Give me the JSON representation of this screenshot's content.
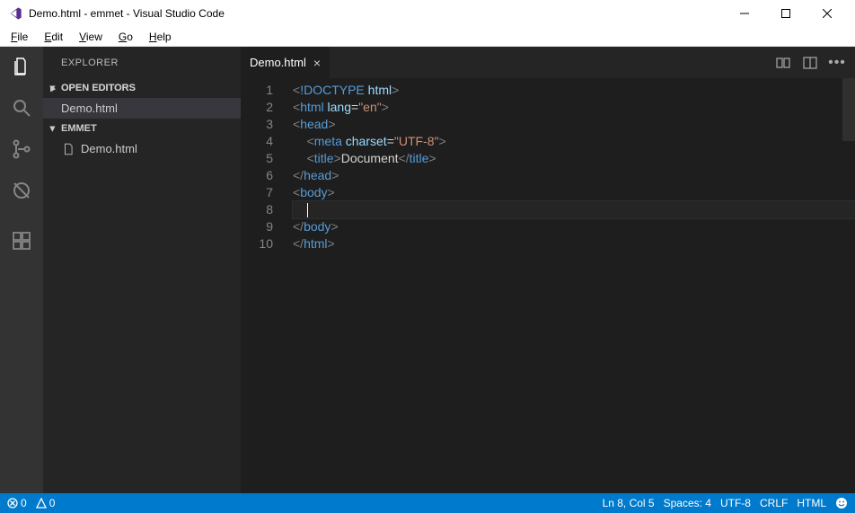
{
  "window": {
    "title": "Demo.html - emmet - Visual Studio Code"
  },
  "menu": {
    "file": "File",
    "edit": "Edit",
    "view": "View",
    "go": "Go",
    "help": "Help"
  },
  "sidebar": {
    "title": "EXPLORER",
    "sections": {
      "openEditors": {
        "label": "OPEN EDITORS",
        "items": [
          "Demo.html"
        ]
      },
      "folder": {
        "label": "EMMET",
        "items": [
          "Demo.html"
        ]
      }
    }
  },
  "tabs": {
    "active": {
      "label": "Demo.html"
    }
  },
  "editor": {
    "lineNumbers": [
      "1",
      "2",
      "3",
      "4",
      "5",
      "6",
      "7",
      "8",
      "9",
      "10"
    ],
    "lines": [
      [
        [
          "bracket",
          "<"
        ],
        [
          "doctype",
          "!DOCTYPE "
        ],
        [
          "attr",
          "html"
        ],
        [
          "bracket",
          ">"
        ]
      ],
      [
        [
          "bracket",
          "<"
        ],
        [
          "tag",
          "html "
        ],
        [
          "attr",
          "lang"
        ],
        [
          "op",
          "="
        ],
        [
          "str",
          "\"en\""
        ],
        [
          "bracket",
          ">"
        ]
      ],
      [
        [
          "bracket",
          "<"
        ],
        [
          "tag",
          "head"
        ],
        [
          "bracket",
          ">"
        ]
      ],
      [
        [
          "text",
          "    "
        ],
        [
          "bracket",
          "<"
        ],
        [
          "tag",
          "meta "
        ],
        [
          "attr",
          "charset"
        ],
        [
          "op",
          "="
        ],
        [
          "str",
          "\"UTF-8\""
        ],
        [
          "bracket",
          ">"
        ]
      ],
      [
        [
          "text",
          "    "
        ],
        [
          "bracket",
          "<"
        ],
        [
          "tag",
          "title"
        ],
        [
          "bracket",
          ">"
        ],
        [
          "text",
          "Document"
        ],
        [
          "bracket",
          "</"
        ],
        [
          "tag",
          "title"
        ],
        [
          "bracket",
          ">"
        ]
      ],
      [
        [
          "bracket",
          "</"
        ],
        [
          "tag",
          "head"
        ],
        [
          "bracket",
          ">"
        ]
      ],
      [
        [
          "bracket",
          "<"
        ],
        [
          "tag",
          "body"
        ],
        [
          "bracket",
          ">"
        ]
      ],
      [
        [
          "text",
          "    "
        ]
      ],
      [
        [
          "bracket",
          "</"
        ],
        [
          "tag",
          "body"
        ],
        [
          "bracket",
          ">"
        ]
      ],
      [
        [
          "bracket",
          "</"
        ],
        [
          "tag",
          "html"
        ],
        [
          "bracket",
          ">"
        ]
      ]
    ],
    "cursorLineIndex": 7
  },
  "statusbar": {
    "errors": "0",
    "warnings": "0",
    "lineCol": "Ln 8, Col 5",
    "spaces": "Spaces: 4",
    "encoding": "UTF-8",
    "eol": "CRLF",
    "language": "HTML"
  }
}
